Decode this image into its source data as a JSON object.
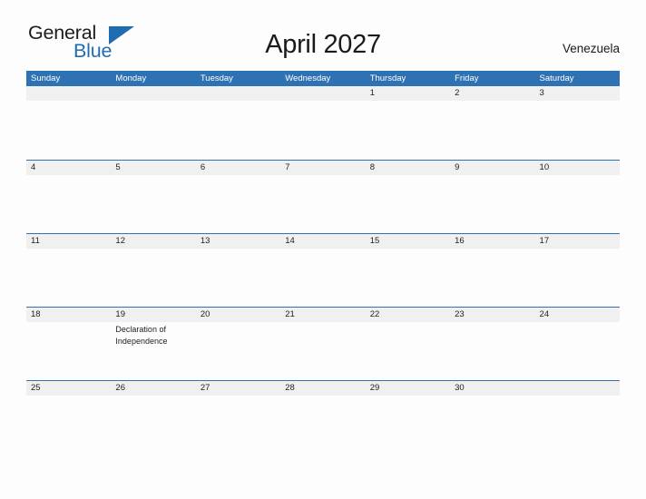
{
  "logo": {
    "word1": "General",
    "word2": "Blue",
    "flag_icon": "blue-pennant-triangle",
    "brand_color": "#1f6cb0"
  },
  "header": {
    "title": "April 2027",
    "country": "Venezuela"
  },
  "colors": {
    "header_blue": "#2f72b3",
    "band_gray": "#f0f0f0",
    "page_background": "#fdfdfd",
    "text": "#1f1f1f"
  },
  "calendar": {
    "month": "April",
    "year": "2027",
    "weekdays": [
      "Sunday",
      "Monday",
      "Tuesday",
      "Wednesday",
      "Thursday",
      "Friday",
      "Saturday"
    ],
    "weeks": [
      [
        {
          "day": "",
          "events": []
        },
        {
          "day": "",
          "events": []
        },
        {
          "day": "",
          "events": []
        },
        {
          "day": "",
          "events": []
        },
        {
          "day": "1",
          "events": []
        },
        {
          "day": "2",
          "events": []
        },
        {
          "day": "3",
          "events": []
        }
      ],
      [
        {
          "day": "4",
          "events": []
        },
        {
          "day": "5",
          "events": []
        },
        {
          "day": "6",
          "events": []
        },
        {
          "day": "7",
          "events": []
        },
        {
          "day": "8",
          "events": []
        },
        {
          "day": "9",
          "events": []
        },
        {
          "day": "10",
          "events": []
        }
      ],
      [
        {
          "day": "11",
          "events": []
        },
        {
          "day": "12",
          "events": []
        },
        {
          "day": "13",
          "events": []
        },
        {
          "day": "14",
          "events": []
        },
        {
          "day": "15",
          "events": []
        },
        {
          "day": "16",
          "events": []
        },
        {
          "day": "17",
          "events": []
        }
      ],
      [
        {
          "day": "18",
          "events": []
        },
        {
          "day": "19",
          "events": [
            "Declaration of",
            "Independence"
          ]
        },
        {
          "day": "20",
          "events": []
        },
        {
          "day": "21",
          "events": []
        },
        {
          "day": "22",
          "events": []
        },
        {
          "day": "23",
          "events": []
        },
        {
          "day": "24",
          "events": []
        }
      ],
      [
        {
          "day": "25",
          "events": []
        },
        {
          "day": "26",
          "events": []
        },
        {
          "day": "27",
          "events": []
        },
        {
          "day": "28",
          "events": []
        },
        {
          "day": "29",
          "events": []
        },
        {
          "day": "30",
          "events": []
        },
        {
          "day": "",
          "events": []
        }
      ]
    ]
  }
}
